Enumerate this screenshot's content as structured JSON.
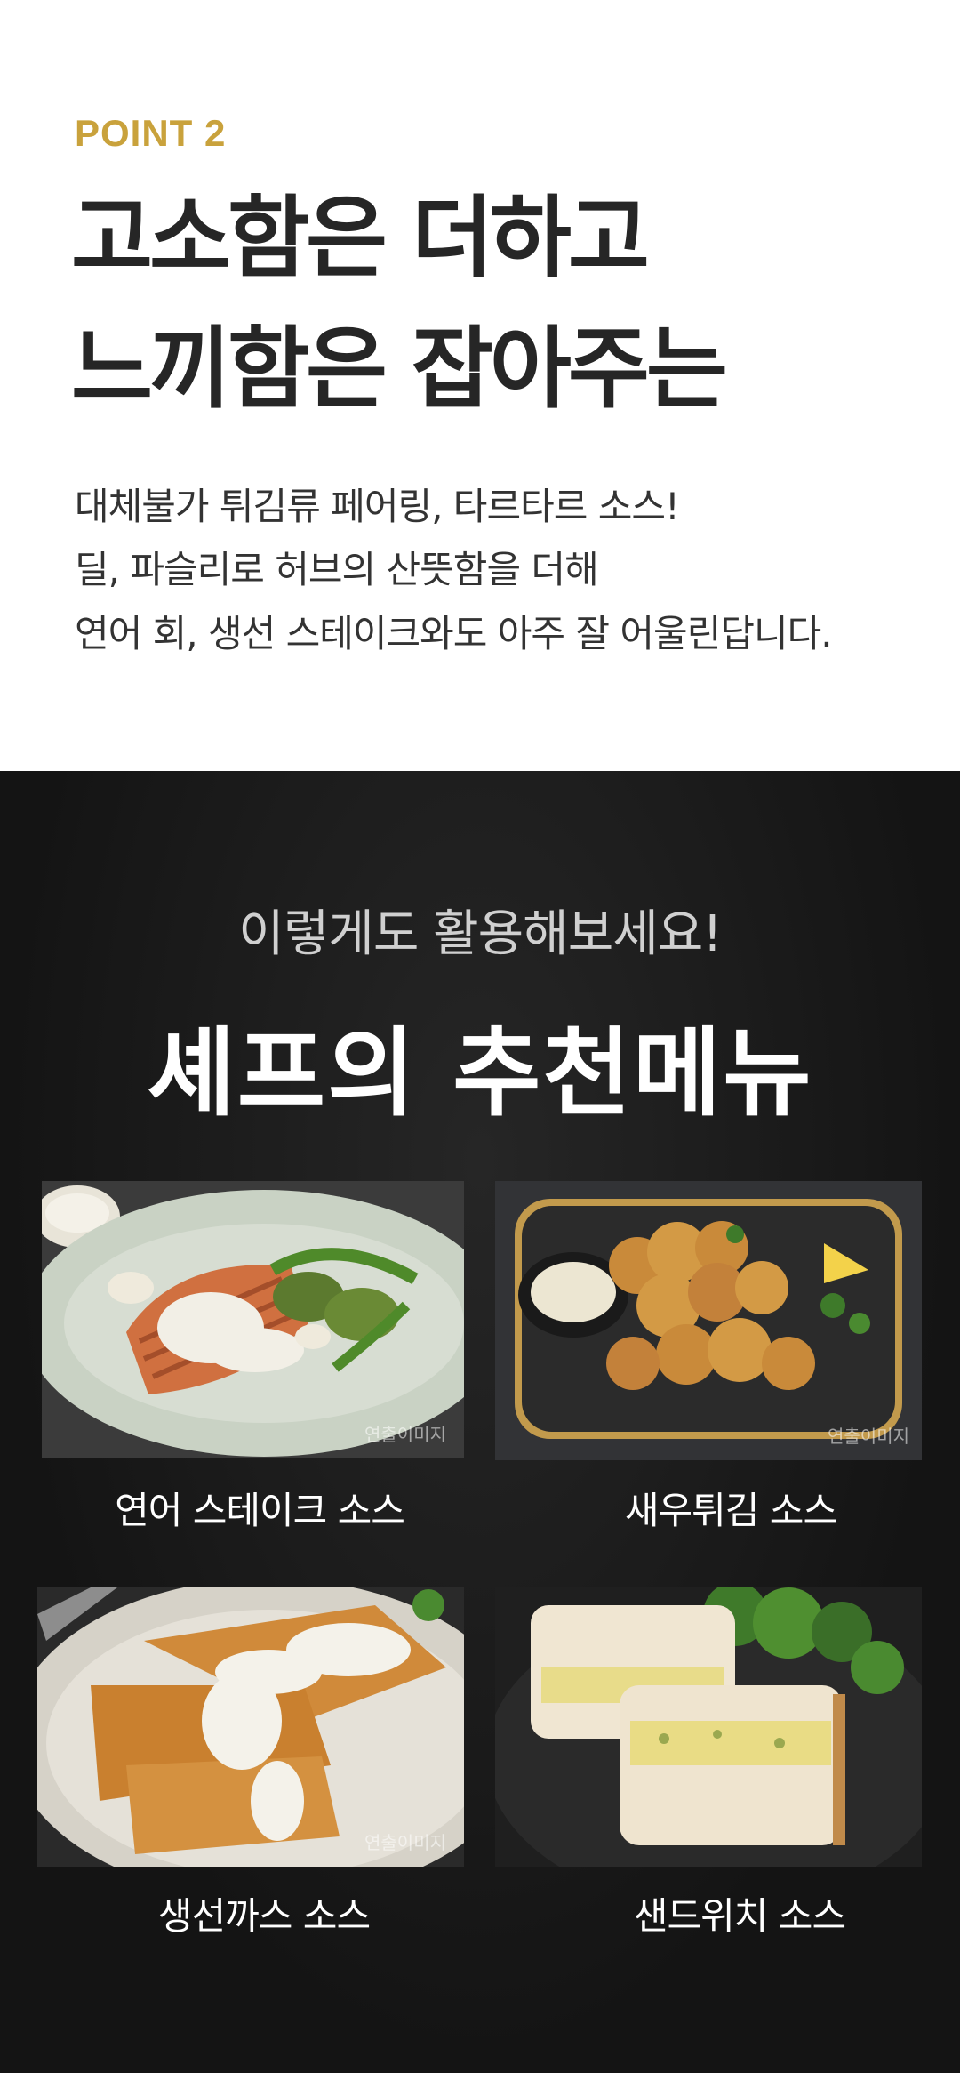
{
  "point": {
    "label": "POINT 2"
  },
  "headline": {
    "line1": "고소함은 더하고",
    "line2": "느끼함은 잡아주는"
  },
  "description": {
    "line1": "대체불가 튀김류 페어링, 타르타르 소스!",
    "line2": "딜, 파슬리로 허브의 산뜻함을 더해",
    "line3": "연어 회, 생선 스테이크와도 아주 잘 어울린답니다."
  },
  "recommend": {
    "subtitle": "이렇게도 활용해보세요!",
    "title": "셰프의 추천메뉴",
    "watermark": "연출이미지",
    "items": [
      {
        "caption": "연어 스테이크 소스"
      },
      {
        "caption": "새우튀김 소스"
      },
      {
        "caption": "생선까스 소스"
      },
      {
        "caption": "샌드위치 소스"
      }
    ]
  },
  "colors": {
    "accent": "#c9a23c",
    "dark_bg": "#141414",
    "headline": "#262626"
  }
}
